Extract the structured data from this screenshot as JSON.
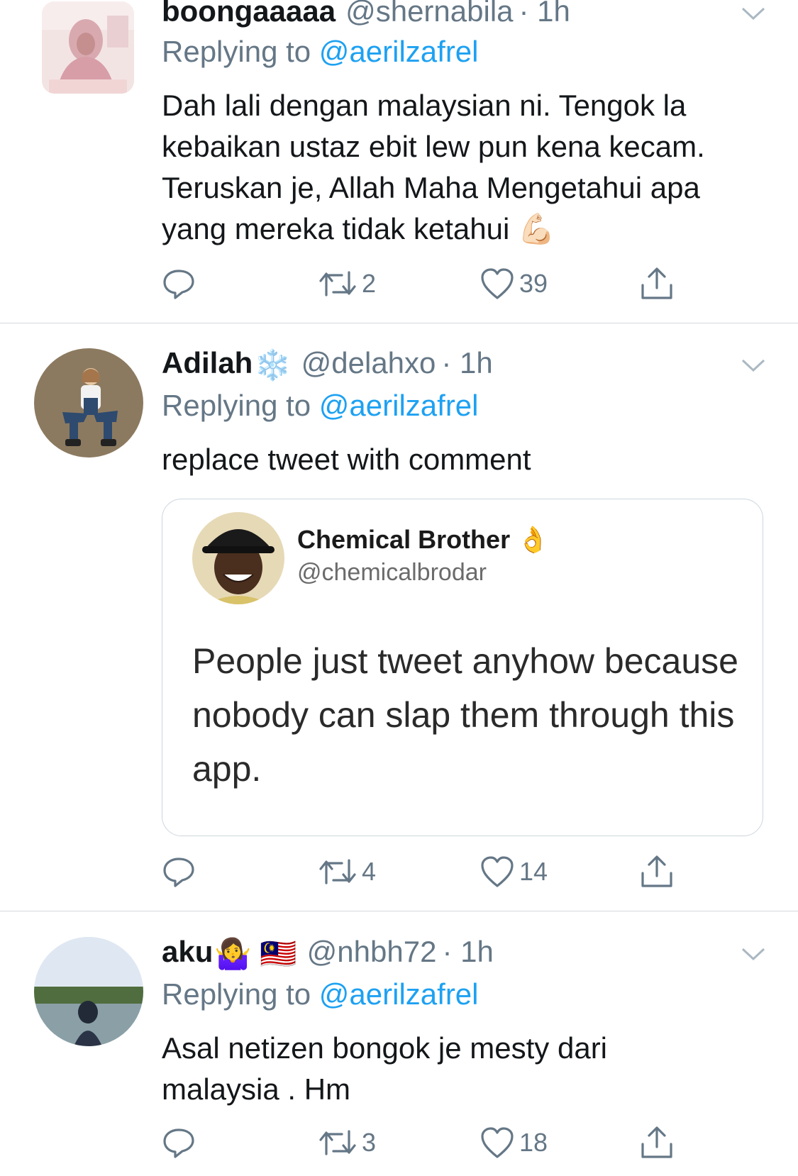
{
  "tweets": [
    {
      "name": "boongaaaaa",
      "handle": "@shernabila",
      "time": "· 1h",
      "reply_prefix": "Replying to",
      "reply_to": "@aerilzafrel",
      "text": "Dah lali dengan malaysian ni. Tengok la kebaikan ustaz ebit lew pun kena kecam. Teruskan je, Allah Maha Mengetahui apa yang mereka tidak ketahui",
      "text_emoji": "💪🏻",
      "retweets": "2",
      "likes": "39"
    },
    {
      "name": "Adilah",
      "name_emoji": "❄️",
      "handle": "@delahxo",
      "time": "· 1h",
      "reply_prefix": "Replying to",
      "reply_to": "@aerilzafrel",
      "text": "replace tweet with comment",
      "quote": {
        "name": "Chemical Brother",
        "name_emoji": "👌",
        "handle": "@chemicalbrodar",
        "text": "People just tweet anyhow because nobody can slap them through this app."
      },
      "retweets": "4",
      "likes": "14"
    },
    {
      "name": "aku",
      "name_emoji": "🤷‍♀️ 🇲🇾",
      "handle": "@nhbh72",
      "time": "· 1h",
      "reply_prefix": "Replying to",
      "reply_to": "@aerilzafrel",
      "text": "Asal netizen bongok je mesty dari malaysia . Hm",
      "retweets": "3",
      "likes": "18"
    }
  ],
  "icons": {
    "reply": "reply-icon",
    "retweet": "retweet-icon",
    "like": "heart-icon",
    "share": "share-icon",
    "menu": "chevron-down-icon"
  },
  "colors": {
    "link": "#1da1f2",
    "secondary": "#657786",
    "text": "#14171a"
  }
}
